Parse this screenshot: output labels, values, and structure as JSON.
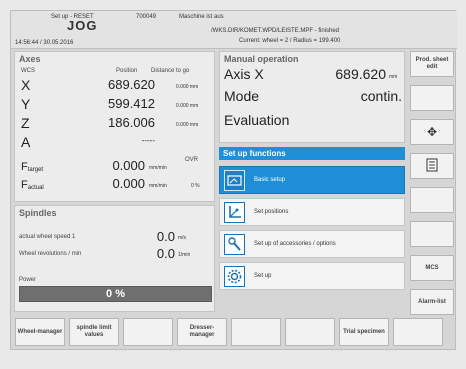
{
  "header": {
    "screen_label": "Set up - RESET",
    "mode": "JOG",
    "datetime": "14:56:44 / 30.05.2016",
    "alarm_code": "700049",
    "alarm_text": "Maschine ist aus",
    "program_path": "/WKS.DIR/KOMET.WPD/LEISTE.MPF - finished",
    "current_info": "Current:  wheel = 2   /  Radius =  199.400"
  },
  "axes": {
    "title": "Axes",
    "col_wcs": "WCS",
    "col_position": "Position",
    "col_distance": "Distance to go",
    "rows": [
      {
        "axis": "X",
        "position": "689.620",
        "distance": "0.000 mm"
      },
      {
        "axis": "Y",
        "position": "599.412",
        "distance": "0.000 mm"
      },
      {
        "axis": "Z",
        "position": "186.006",
        "distance": "0.000 mm"
      },
      {
        "axis": "A",
        "position": "-----",
        "distance": ""
      }
    ],
    "f_target": {
      "letter": "F",
      "sub": "target",
      "value": "0.000",
      "unit": "mm/min",
      "ovr_label": "OVR",
      "ovr_value": ""
    },
    "f_actual": {
      "letter": "F",
      "sub": "actual",
      "value": "0.000",
      "unit": "mm/min",
      "ovr_value": "0  %"
    }
  },
  "spindles": {
    "title": "Spindles",
    "rows": [
      {
        "label": "actual wheel speed 1",
        "value": "0.0",
        "unit": "m/s"
      },
      {
        "label": "Wheel revolutions / min",
        "value": "0.0",
        "unit": "1/min"
      }
    ],
    "power_label": "Power",
    "power_value": "0 %"
  },
  "manual": {
    "title": "Manual operation",
    "axis_label": "Axis  X",
    "axis_value": "689.620",
    "axis_unit": "mm",
    "mode_label": "Mode",
    "mode_value": "contin.",
    "evaluation_label": "Evaluation"
  },
  "setup_functions": {
    "title": "Set up functions",
    "items": [
      {
        "label": "Basic setup",
        "icon": "basic-setup-icon",
        "selected": true
      },
      {
        "label": "Set positions",
        "icon": "set-positions-icon",
        "selected": false
      },
      {
        "label": "Set up of accessories / options",
        "icon": "accessories-icon",
        "selected": false
      },
      {
        "label": "Set up",
        "icon": "gear-icon",
        "selected": false
      }
    ]
  },
  "right_softkeys": [
    {
      "label": "Prod. sheet edit"
    },
    {
      "label": ""
    },
    {
      "label": "",
      "icon": "move-arrows-icon"
    },
    {
      "label": "",
      "icon": "document-icon"
    },
    {
      "label": ""
    },
    {
      "label": ""
    },
    {
      "label": "MCS"
    },
    {
      "label": "Alarm-list"
    }
  ],
  "bottom_softkeys": [
    {
      "label": "Wheel-manager"
    },
    {
      "label": "spindle limit values"
    },
    {
      "label": ""
    },
    {
      "label": "Dresser-manager"
    },
    {
      "label": ""
    },
    {
      "label": ""
    },
    {
      "label": "Trial specimen"
    },
    {
      "label": ""
    }
  ],
  "colors": {
    "accent": "#1e90d8",
    "panel": "#ececec",
    "power_bar": "#6f6f6f"
  }
}
